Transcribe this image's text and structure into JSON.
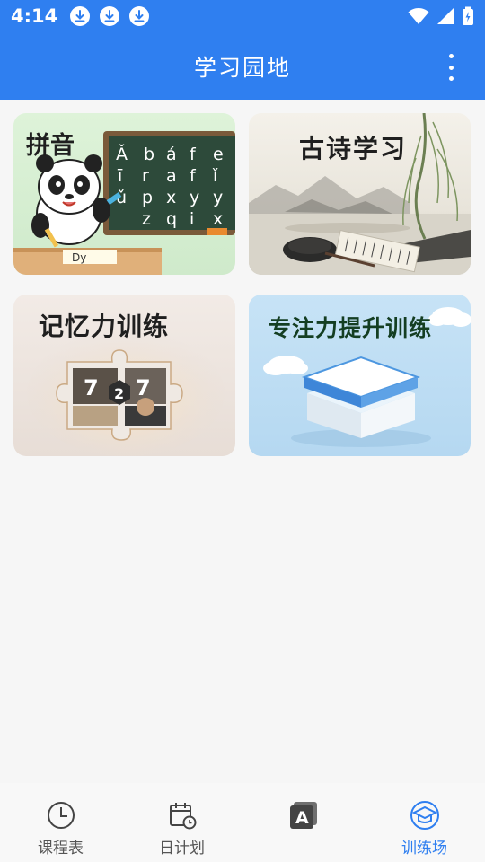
{
  "status": {
    "time": "4:14"
  },
  "appbar": {
    "title": "学习园地"
  },
  "cards": {
    "pinyin": {
      "title": "拼音"
    },
    "poetry": {
      "title": "古诗学习"
    },
    "memory": {
      "title": "记忆力训练"
    },
    "focus": {
      "title": "专注力提升训练"
    }
  },
  "nav": [
    {
      "label": "课程表",
      "icon": "clock-icon"
    },
    {
      "label": "日计划",
      "icon": "calendar-icon"
    },
    {
      "label": "",
      "icon": "letter-a-icon"
    },
    {
      "label": "训练场",
      "icon": "graduation-cap-icon"
    }
  ],
  "colors": {
    "primary": "#2f7ff0",
    "background": "#f6f6f6"
  }
}
